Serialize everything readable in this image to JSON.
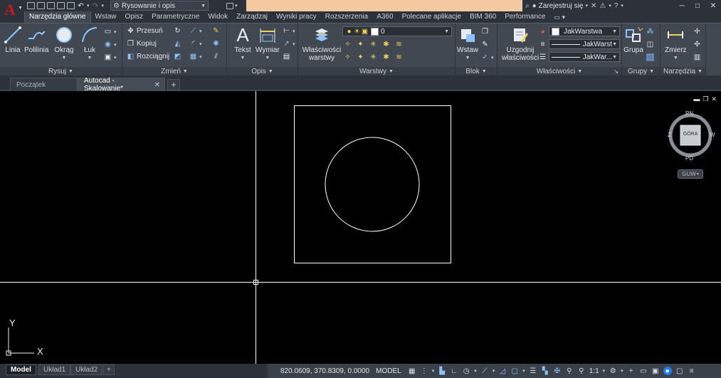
{
  "app": {
    "logo_letter": "A",
    "workspace": "Rysowanie i opis",
    "sign_in": "Zarejestruj się"
  },
  "ribbon_tabs": [
    "Narzędzia główne",
    "Wstaw",
    "Opisz",
    "Parametryczne",
    "Widok",
    "Zarządzaj",
    "Wyniki pracy",
    "Rozszerzenia",
    "A360",
    "Polecane aplikacje",
    "BIM 360",
    "Performance"
  ],
  "panels": {
    "draw": {
      "title": "Rysuj",
      "buttons": [
        "Linia",
        "Polilinia",
        "Okrąg",
        "Łuk"
      ]
    },
    "modify": {
      "title": "Zmień",
      "items": [
        "Przesuń",
        "Kopiuj",
        "Rozciągnij"
      ]
    },
    "annotation": {
      "title": "Opis",
      "buttons": [
        "Tekst",
        "Wymiar"
      ]
    },
    "layers": {
      "title": "Warstwy",
      "props_button": "Właściwości warstwy",
      "current_layer": "0"
    },
    "block": {
      "title": "Blok",
      "insert_button": "Wstaw"
    },
    "properties": {
      "title": "Właściwości",
      "match_button": "Uzgodnij właściwości",
      "color": "JakWarstwa",
      "linetype": "JakWarst",
      "lineweight": "JakWar..."
    },
    "groups": {
      "title": "Grupy",
      "button": "Grupa"
    },
    "utilities": {
      "title": "Narzędzia",
      "button": "Zmierz"
    }
  },
  "doc_tabs": {
    "start": "Początek",
    "active": "Autocad - Skalowanie*",
    "add": "+"
  },
  "viewcube": {
    "top": "GÓRA",
    "north": "PN",
    "south": "PD",
    "east": "W",
    "west": "Z",
    "wcs": "GUW"
  },
  "ucs": {
    "x": "X",
    "y": "Y"
  },
  "layout_tabs": [
    "Model",
    "Układ1",
    "Układ2"
  ],
  "status": {
    "coords": "820.0609, 370.8309, 0.0000",
    "space": "MODEL",
    "scale": "1:1"
  },
  "colors": {
    "accent": "#1c7ff0",
    "ribbon": "#414852",
    "canvas": "#000000",
    "title_strip": "#f2c9a0"
  }
}
